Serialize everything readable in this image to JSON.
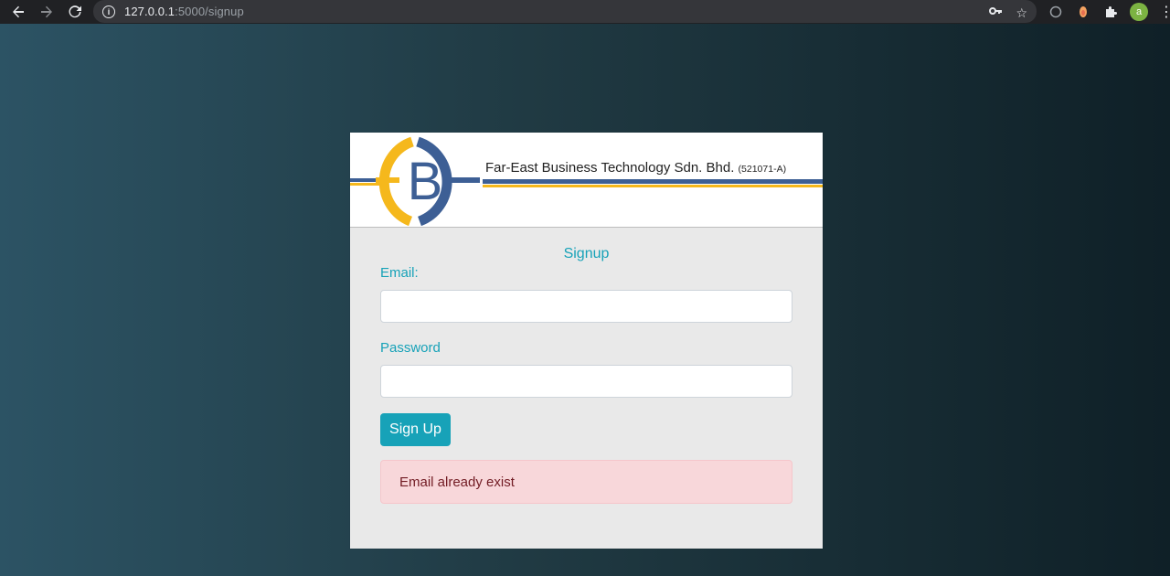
{
  "browser": {
    "url_host": "127.0.0.1",
    "url_rest": ":5000/signup",
    "profile_initial": "a"
  },
  "banner": {
    "company_name": "Far-East Business Technology Sdn. Bhd.",
    "registration": "(521071-A)",
    "logo_letter": "B"
  },
  "form": {
    "title": "Signup",
    "email_label": "Email:",
    "email_value": "",
    "password_label": "Password",
    "password_value": "",
    "submit_label": "Sign Up",
    "alert_message": "Email already exist"
  },
  "colors": {
    "accent": "#17a2b8",
    "alert_bg": "#f8d7da",
    "alert_text": "#721c24",
    "logo_yellow": "#f5b81c",
    "logo_blue": "#3d5f95"
  }
}
